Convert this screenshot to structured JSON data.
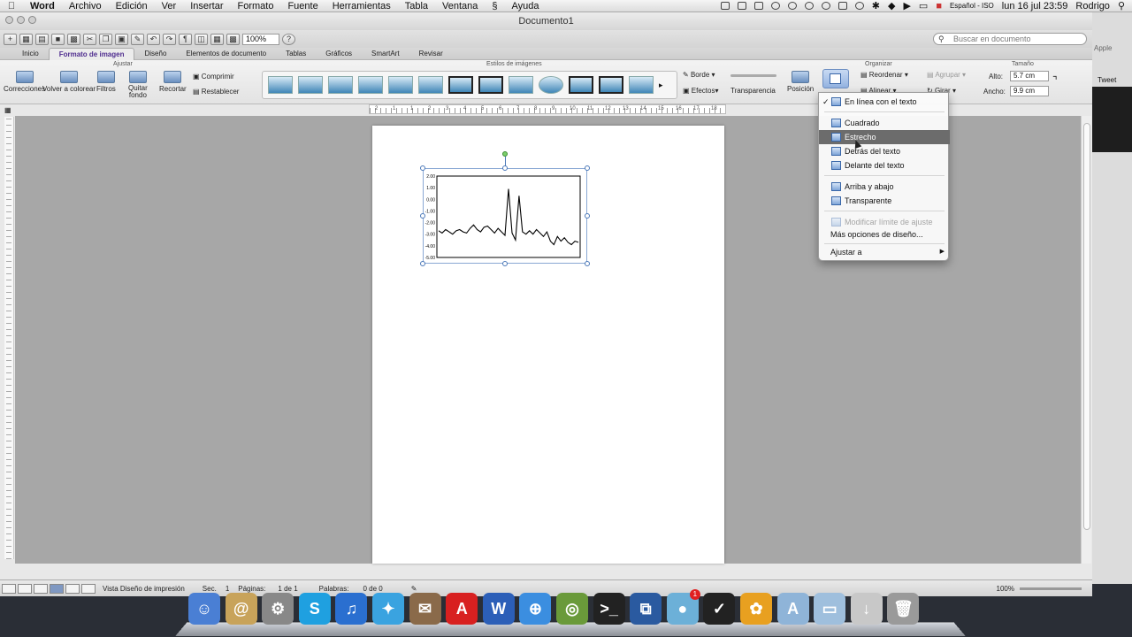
{
  "menubar": {
    "app": "Word",
    "items": [
      "Archivo",
      "Edición",
      "Ver",
      "Insertar",
      "Formato",
      "Fuente",
      "Herramientas",
      "Tabla",
      "Ventana",
      "Ayuda"
    ],
    "language": "Español - ISO",
    "datetime": "lun 16 jul  23:59",
    "user": "Rodrigo"
  },
  "window": {
    "title": "Documento1",
    "zoom": "100%",
    "search_placeholder": "Buscar en documento"
  },
  "tabs": [
    "Inicio",
    "Formato de imagen",
    "Diseño",
    "Elementos de documento",
    "Tablas",
    "Gráficos",
    "SmartArt",
    "Revisar"
  ],
  "ribbon": {
    "group_adjust": "Ajustar",
    "group_styles": "Estilos de imágenes",
    "group_arrange": "Organizar",
    "group_size": "Tamaño",
    "corrections": "Correcciones",
    "recolor": "Volver a colorear",
    "filters": "Filtros",
    "remove_bg_1": "Quitar",
    "remove_bg_2": "fondo",
    "crop": "Recortar",
    "compress": "Comprimir",
    "reset": "Restablecer",
    "border": "Borde",
    "effects": "Efectos",
    "transparency": "Transparencia",
    "position": "Posición",
    "reorder": "Reordenar",
    "align": "Alinear",
    "group": "Agrupar",
    "rotate": "Girar",
    "height_label": "Alto:",
    "height_value": "5.7 cm",
    "width_label": "Ancho:",
    "width_value": "9.9 cm"
  },
  "ruler_labels": [
    "2",
    "1",
    "1",
    "2",
    "3",
    "4",
    "5",
    "6",
    "7",
    "8",
    "9",
    "10",
    "11",
    "12",
    "13",
    "14",
    "15",
    "16",
    "17",
    "18"
  ],
  "chart_data": {
    "type": "line",
    "y_ticks": [
      "2.00",
      "1.00",
      "0.00",
      "-1.00",
      "-2.00",
      "-3.00",
      "-4.00",
      "-5.00"
    ],
    "ylim": [
      -5,
      2
    ],
    "series": [
      {
        "values": [
          -2.7,
          -2.9,
          -2.6,
          -2.8,
          -3.0,
          -2.7,
          -2.6,
          -2.8,
          -2.9,
          -2.5,
          -2.2,
          -2.6,
          -2.8,
          -2.4,
          -2.3,
          -2.6,
          -2.9,
          -2.5,
          -2.8,
          -3.1,
          0.9,
          -2.9,
          -3.5,
          0.3,
          -2.8,
          -3.0,
          -2.7,
          -3.0,
          -2.6,
          -2.9,
          -3.2,
          -2.8,
          -3.6,
          -3.9,
          -3.2,
          -3.6,
          -3.3,
          -3.7,
          -3.9,
          -3.6,
          -3.7
        ]
      }
    ]
  },
  "dropdown": {
    "items": [
      {
        "label": "En línea con el texto",
        "checked": true
      },
      {
        "label": "Cuadrado"
      },
      {
        "label": "Estrecho",
        "highlighted": true
      },
      {
        "label": "Detrás del texto"
      },
      {
        "label": "Delante del texto"
      },
      {
        "label": "Arriba y abajo"
      },
      {
        "label": "Transparente"
      },
      {
        "label": "Modificar límite de ajuste",
        "disabled": true
      },
      {
        "label": "Más opciones de diseño..."
      },
      {
        "label": "Ajustar a",
        "submenu": true
      }
    ]
  },
  "statusbar": {
    "view": "Vista Diseño de impresión",
    "sec_label": "Sec.",
    "sec_value": "1",
    "pages_label": "Páginas:",
    "pages_value": "1 de 1",
    "words_label": "Palabras:",
    "words_value": "0 de 0",
    "zoom": "100%"
  },
  "rightwin": {
    "tweet": "Tweet",
    "apple": "Apple"
  },
  "dock": {
    "icons": [
      "finder-icon",
      "mail-icon",
      "system-preferences-icon",
      "skype-icon",
      "itunes-icon",
      "twitter-icon",
      "preview-icon",
      "adobe-reader-icon",
      "word-icon",
      "safari-icon",
      "network-icon",
      "terminal-icon",
      "parallels-icon",
      "app-icon",
      "nike-icon",
      "iphoto-icon",
      "applications-folder-icon",
      "documents-folder-icon",
      "downloads-icon",
      "trash-icon"
    ],
    "badge": "1"
  }
}
